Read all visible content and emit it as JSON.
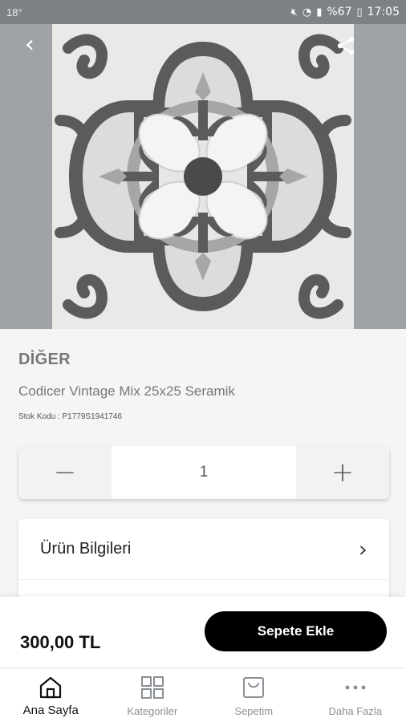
{
  "status_bar": {
    "temperature": "18°",
    "battery": "%67",
    "time": "17:05"
  },
  "product": {
    "brand": "DİĞER",
    "name": "Codicer Vintage Mix 25x25 Seramik",
    "stock_code": "Stok Kodu : P1779S1941746",
    "quantity": "1",
    "price": "300,00 TL"
  },
  "info": {
    "urun_bilgileri_label": "Ürün Bilgileri"
  },
  "actions": {
    "add_to_cart": "Sepete Ekle"
  },
  "tabs": [
    {
      "label": "Ana Sayfa",
      "icon": "home-icon",
      "active": true
    },
    {
      "label": "Kategoriler",
      "icon": "grid-icon",
      "active": false
    },
    {
      "label": "Sepetim",
      "icon": "bag-icon",
      "active": false
    },
    {
      "label": "Daha Fazla",
      "icon": "more-icon",
      "active": false
    }
  ],
  "colors": {
    "accent": "#000000",
    "tile_dark": "#5b5b5b",
    "tile_mid": "#a6a6a6",
    "tile_light": "#dcdcdc"
  }
}
